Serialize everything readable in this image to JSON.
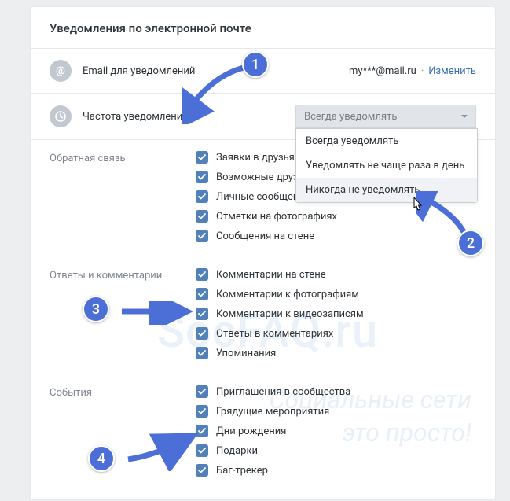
{
  "title": "Уведомления по электронной почте",
  "email_row": {
    "label": "Email для уведомлений",
    "value": "my***@mail.ru",
    "action": "Изменить"
  },
  "freq_row": {
    "label": "Частота уведомлений",
    "selected": "Всегда уведомлять",
    "options": [
      "Всегда уведомлять",
      "Уведомлять не чаще раза в день",
      "Никогда не уведомлять"
    ]
  },
  "sections": [
    {
      "label": "Обратная связь",
      "items": [
        "Заявки в друзья",
        "Возможные друзья",
        "Личные сообщения",
        "Отметки на фотографиях",
        "Сообщения на стене"
      ]
    },
    {
      "label": "Ответы и комментарии",
      "items": [
        "Комментарии на стене",
        "Комментарии к фотографиям",
        "Комментарии к видеозаписям",
        "Ответы в комментариях",
        "Упоминания"
      ]
    },
    {
      "label": "События",
      "items": [
        "Приглашения в сообщества",
        "Грядущие мероприятия",
        "Дни рождения",
        "Подарки",
        "Баг-трекер"
      ]
    }
  ],
  "watermark": {
    "line1": "SocFAQ.ru",
    "line2": "Социальные сети\nэто просто!"
  },
  "badges": {
    "b1": "1",
    "b2": "2",
    "b3": "3",
    "b4": "4"
  }
}
